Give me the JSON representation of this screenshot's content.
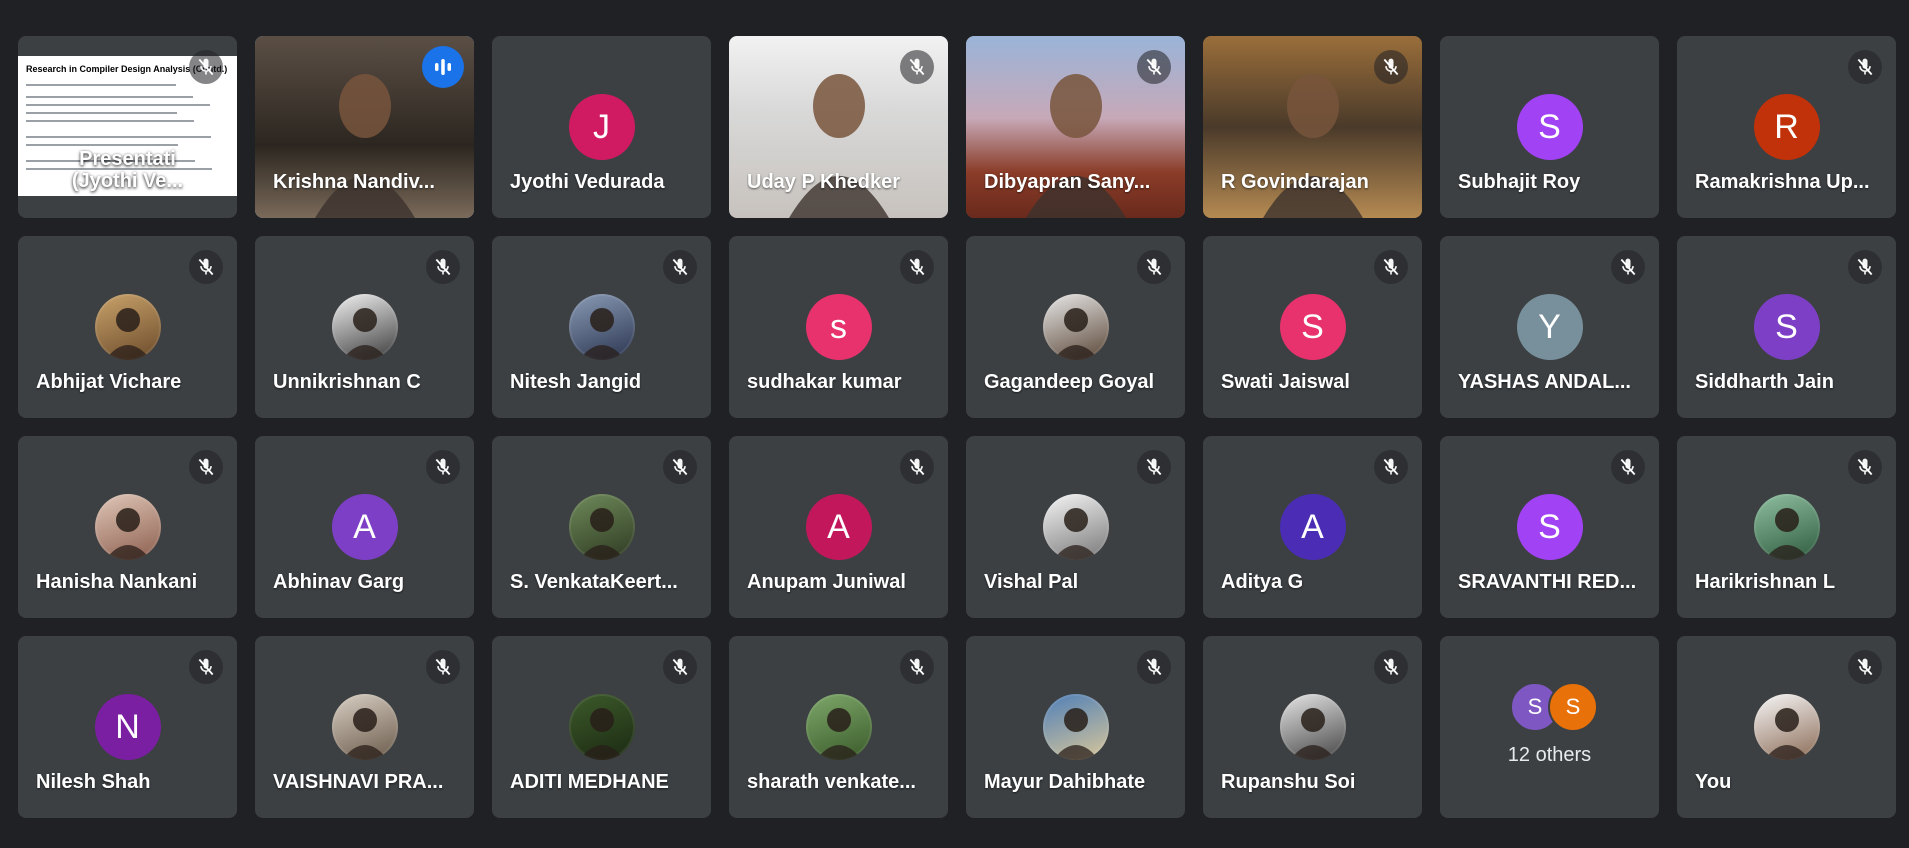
{
  "tiles": [
    {
      "name": "(Jyothi Ve...",
      "presentation_label": "Presentati",
      "slide_title": "Research in Compiler Design Analysis (Contd.)",
      "type": "presentation",
      "muted": true
    },
    {
      "name": "Krishna Nandiv...",
      "type": "video",
      "speaking": true
    },
    {
      "name": "Jyothi Vedurada",
      "initial": "J",
      "color": "#d01b63",
      "type": "initial"
    },
    {
      "name": "Uday P Khedker",
      "type": "video",
      "muted": true
    },
    {
      "name": "Dibyapran Sany...",
      "type": "video",
      "muted": true
    },
    {
      "name": "R Govindarajan",
      "type": "video",
      "muted": true
    },
    {
      "name": "Subhajit Roy",
      "initial": "S",
      "color": "#a142f4",
      "type": "initial"
    },
    {
      "name": "Ramakrishna Up...",
      "initial": "R",
      "color": "#c1310a",
      "type": "initial",
      "muted": true
    },
    {
      "name": "Abhijat Vichare",
      "type": "photo",
      "muted": true
    },
    {
      "name": "Unnikrishnan C",
      "type": "photo",
      "muted": true
    },
    {
      "name": "Nitesh Jangid",
      "type": "photo",
      "muted": true
    },
    {
      "name": "sudhakar kumar",
      "initial": "s",
      "color": "#e8326e",
      "type": "initial",
      "muted": true
    },
    {
      "name": "Gagandeep Goyal",
      "type": "photo",
      "muted": true
    },
    {
      "name": "Swati Jaiswal",
      "initial": "S",
      "color": "#e8326e",
      "type": "initial",
      "muted": true
    },
    {
      "name": "YASHAS ANDAL...",
      "initial": "Y",
      "color": "#78909c",
      "type": "initial",
      "muted": true
    },
    {
      "name": "Siddharth Jain",
      "initial": "S",
      "color": "#7e3fc7",
      "type": "initial",
      "muted": true
    },
    {
      "name": "Hanisha Nankani",
      "type": "photo",
      "muted": true
    },
    {
      "name": "Abhinav Garg",
      "initial": "A",
      "color": "#7e3fc7",
      "type": "initial",
      "muted": true
    },
    {
      "name": "S. VenkataKeert...",
      "type": "photo",
      "muted": true
    },
    {
      "name": "Anupam Juniwal",
      "initial": "A",
      "color": "#c2185b",
      "type": "initial",
      "muted": true
    },
    {
      "name": "Vishal Pal",
      "type": "photo",
      "muted": true
    },
    {
      "name": "Aditya G",
      "initial": "A",
      "color": "#4a2db4",
      "type": "initial",
      "muted": true
    },
    {
      "name": "SRAVANTHI RED...",
      "initial": "S",
      "color": "#a142f4",
      "type": "initial",
      "muted": true
    },
    {
      "name": "Harikrishnan L",
      "type": "photo",
      "muted": true
    },
    {
      "name": "Nilesh Shah",
      "initial": "N",
      "color": "#7b1fa2",
      "type": "initial",
      "muted": true
    },
    {
      "name": "VAISHNAVI PRA...",
      "type": "photo",
      "muted": true
    },
    {
      "name": "ADITI MEDHANE",
      "type": "photo",
      "muted": true
    },
    {
      "name": "sharath venkate...",
      "type": "photo",
      "muted": true
    },
    {
      "name": "Mayur Dahibhate",
      "type": "photo",
      "muted": true
    },
    {
      "name": "Rupanshu Soi",
      "type": "photo",
      "muted": true
    },
    {
      "name": "12 others",
      "type": "others",
      "others_initials": [
        "S",
        "S"
      ],
      "others_colors": [
        "#7e57c2",
        "#e8710a"
      ]
    },
    {
      "name": "You",
      "type": "photo",
      "muted": true
    }
  ],
  "icons": {
    "mute": "mic-off-icon",
    "speaking": "audio-level-icon"
  }
}
